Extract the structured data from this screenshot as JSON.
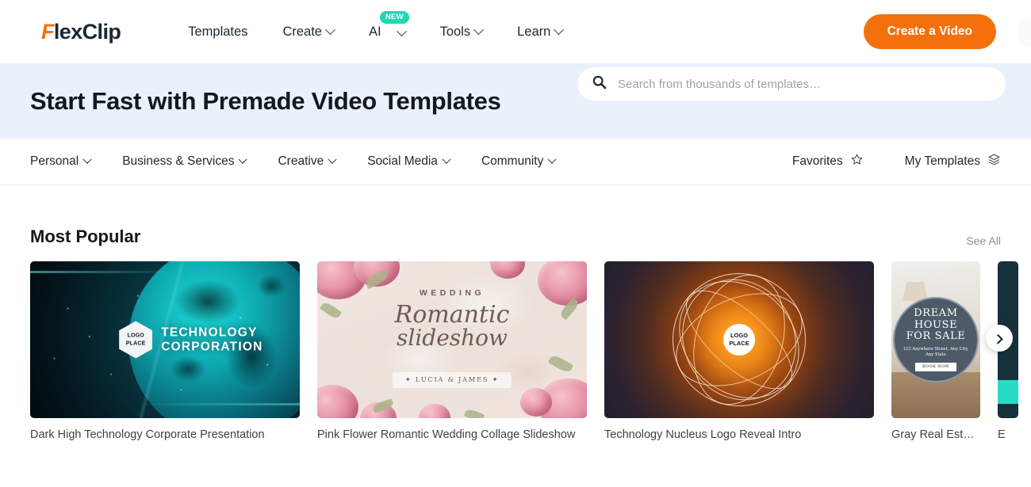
{
  "brand": {
    "logo_prefix": "F",
    "logo_rest": "lexClip"
  },
  "header": {
    "nav": [
      {
        "label": "Templates",
        "has_chevron": false,
        "badge": null
      },
      {
        "label": "Create",
        "has_chevron": true,
        "badge": null
      },
      {
        "label": "AI",
        "has_chevron": true,
        "badge": "NEW"
      },
      {
        "label": "Tools",
        "has_chevron": true,
        "badge": null
      },
      {
        "label": "Learn",
        "has_chevron": true,
        "badge": null
      }
    ],
    "cta_label": "Create a Video"
  },
  "hero": {
    "title": "Start Fast with Premade Video Templates",
    "search_placeholder": "Search from thousands of templates…",
    "search_value": "",
    "search_icon": "search-icon",
    "background_color": "#e9f2fb"
  },
  "categories": {
    "items": [
      {
        "label": "Personal"
      },
      {
        "label": "Business & Services"
      },
      {
        "label": "Creative"
      },
      {
        "label": "Social Media"
      },
      {
        "label": "Community"
      }
    ],
    "favorites_label": "Favorites",
    "favorites_icon": "star-outline-icon",
    "my_templates_label": "My Templates",
    "my_templates_icon": "layers-icon"
  },
  "section": {
    "title": "Most Popular",
    "see_all_label": "See All",
    "next_icon": "chevron-right-icon"
  },
  "cards": [
    {
      "title": "Dark High Technology Corporate Presentation",
      "orientation": "landscape",
      "overlay": {
        "badge_line1": "LOGO",
        "badge_line2": "PLACE",
        "headline_line1": "TECHNOLOGY",
        "headline_line2": "CORPORATION"
      }
    },
    {
      "title": "Pink Flower Romantic Wedding Collage Slideshow",
      "orientation": "landscape",
      "overlay": {
        "kicker": "WEDDING",
        "script_line1": "Romantic",
        "script_line2": "slideshow",
        "names": "✦ LUCIA & JAMES ✦"
      }
    },
    {
      "title": "Technology Nucleus Logo Reveal Intro",
      "orientation": "landscape",
      "overlay": {
        "badge_line1": "LOGO",
        "badge_line2": "PLACE"
      }
    },
    {
      "title": "Gray Real Estat…",
      "orientation": "portrait",
      "overlay": {
        "line1": "DREAM",
        "line2": "HOUSE",
        "line3": "FOR SALE",
        "address": "123 Anywhere Street, Any City, Any State",
        "button": "BOOK NOW"
      }
    },
    {
      "title": "E",
      "orientation": "sliver",
      "overlay": {}
    }
  ],
  "colors": {
    "brand_orange": "#f4700c",
    "badge_teal": "#1ed8b4",
    "hero_blue": "#e9f2fb",
    "text_dark": "#14181f"
  }
}
